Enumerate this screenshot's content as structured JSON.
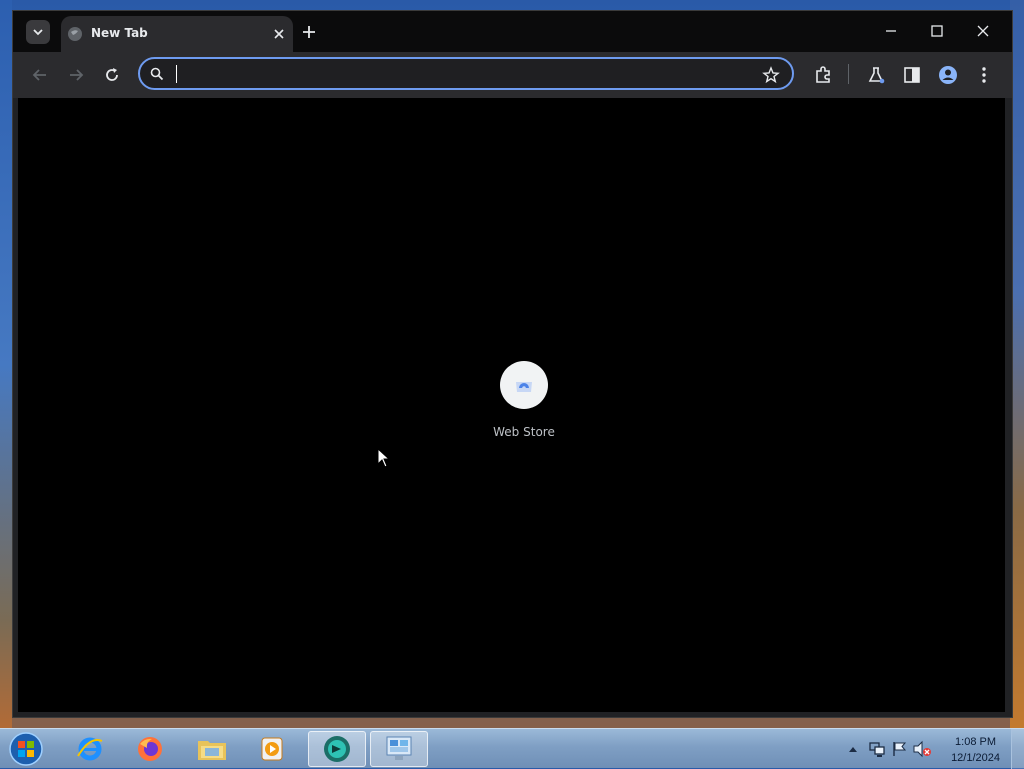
{
  "browser": {
    "tab": {
      "title": "New Tab"
    },
    "omnibox": {
      "value": "",
      "placeholder": ""
    },
    "accent_color": "#6e9bf0"
  },
  "content": {
    "shortcuts": [
      {
        "label": "Web Store",
        "icon": "webstore-icon"
      }
    ]
  },
  "taskbar": {
    "apps": [
      "start-orb",
      "internet-explorer",
      "firefox",
      "file-explorer",
      "media-player",
      "chrome",
      "control-panel"
    ],
    "clock": {
      "time": "1:08 PM",
      "date": "12/1/2024"
    }
  }
}
